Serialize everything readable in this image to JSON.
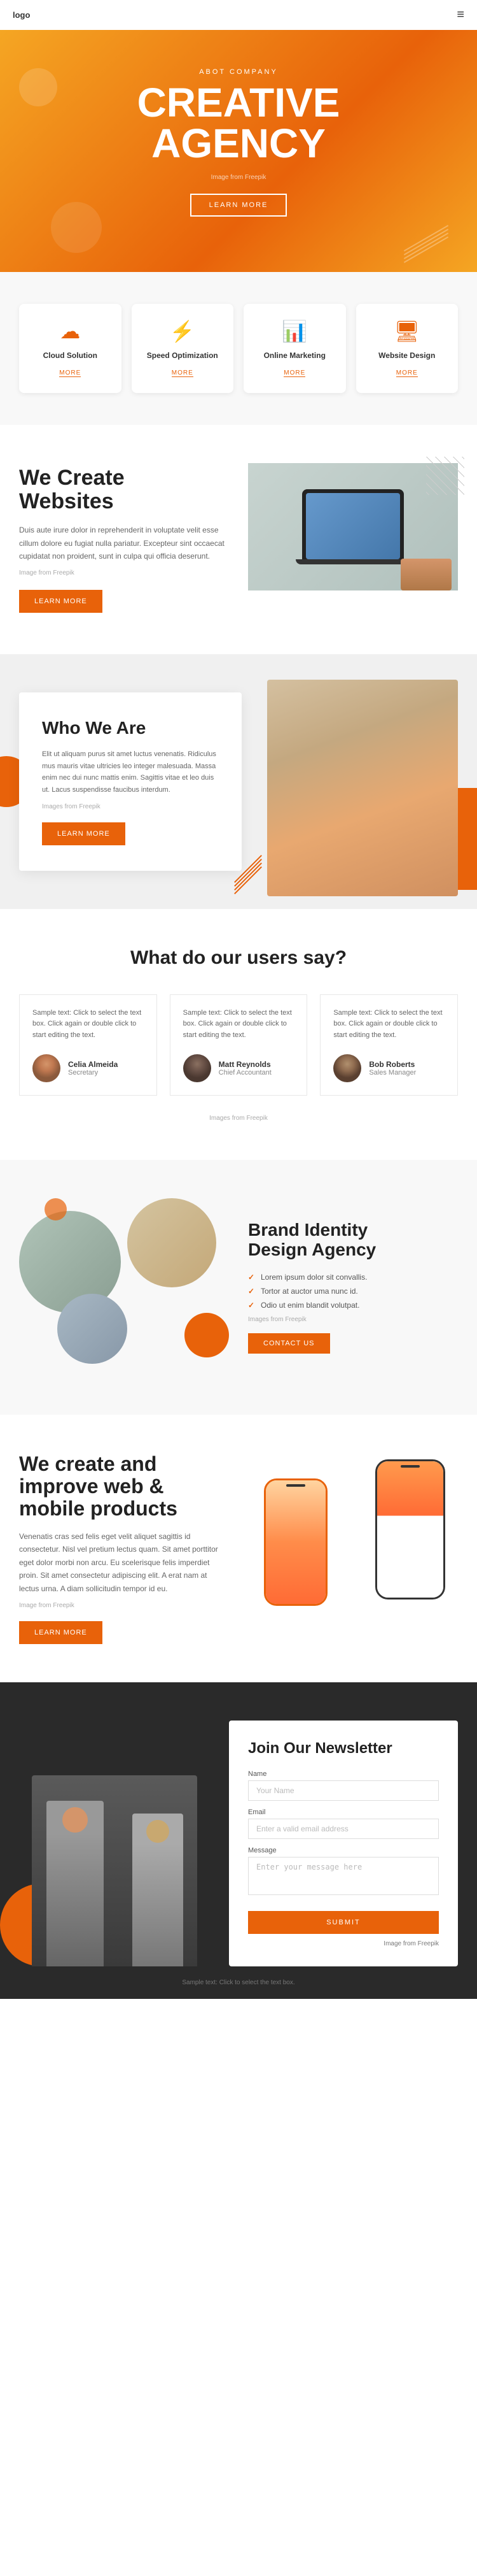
{
  "header": {
    "logo": "logo",
    "hamburger_icon": "≡"
  },
  "hero": {
    "subtitle": "ABOT COMPANY",
    "title_line1": "CREATIVE",
    "title_line2": "AGENCY",
    "img_credit": "Image from Freepik",
    "cta_label": "LEARN MORE"
  },
  "services": {
    "cards": [
      {
        "icon": "☁",
        "title": "Cloud Solution",
        "more": "MORE"
      },
      {
        "icon": "⚡",
        "title": "Speed Optimization",
        "more": "MORE"
      },
      {
        "icon": "📊",
        "title": "Online Marketing",
        "more": "MORE"
      },
      {
        "icon": "🖥",
        "title": "Website Design",
        "more": "MORE"
      }
    ]
  },
  "we_create": {
    "title_line1": "We Create",
    "title_line2": "Websites",
    "body": "Duis aute irure dolor in reprehenderit in voluptate velit esse cillum dolore eu fugiat nulla pariatur. Excepteur sint occaecat cupidatat non proident, sunt in culpa qui officia deserunt.",
    "img_credit": "Image from Freepik",
    "cta_label": "LEARN MORE"
  },
  "who_we_are": {
    "title": "Who We Are",
    "body": "Elit ut aliquam purus sit amet luctus venenatis. Ridiculus mus mauris vitae ultricies leo integer malesuada. Massa enim nec dui nunc mattis enim. Sagittis vitae et leo duis ut. Lacus suspendisse faucibus interdum.",
    "img_credit": "Images from Freepik",
    "cta_label": "LEARN MORE"
  },
  "testimonials": {
    "title": "What do our users say?",
    "cards": [
      {
        "text": "Sample text: Click to select the text box. Click again or double click to start editing the text.",
        "name": "Celia Almeida",
        "role": "Secretary"
      },
      {
        "text": "Sample text: Click to select the text box. Click again or double click to start editing the text.",
        "name": "Matt Reynolds",
        "role": "Chief Accountant"
      },
      {
        "text": "Sample text: Click to select the text box. Click again or double click to start editing the text.",
        "name": "Bob Roberts",
        "role": "Sales Manager"
      }
    ],
    "img_credit": "Images from Freepik"
  },
  "brand_identity": {
    "title_line1": "Brand Identity",
    "title_line2": "Design Agency",
    "checklist": [
      "Lorem ipsum dolor sit convallis.",
      "Tortor at auctor uma nunc id.",
      "Odio ut enim blandit volutpat."
    ],
    "img_credit": "Images from Freepik",
    "cta_label": "CONTACT US"
  },
  "mobile_products": {
    "title_line1": "We create and",
    "title_line2": "improve web &",
    "title_line3": "mobile products",
    "body": "Venenatis cras sed felis eget velit aliquet sagittis id consectetur. Nisl vel pretium lectus quam. Sit amet porttitor eget dolor morbi non arcu. Eu scelerisque felis imperdiet proin. Sit amet consectetur adipiscing elit. A erat nam at lectus urna. A diam sollicitudin tempor id eu.",
    "img_credit": "Image from Freepik",
    "cta_label": "LEARN MORE"
  },
  "newsletter": {
    "title": "Join Our Newsletter",
    "fields": [
      {
        "label": "Name",
        "placeholder": "Your Name"
      },
      {
        "label": "Email",
        "placeholder": "Enter a valid email address"
      },
      {
        "label": "Message",
        "placeholder": "Enter your message here"
      }
    ],
    "submit_label": "SUBMIT",
    "img_credit": "Image from Freepik"
  },
  "footer": {
    "note": "Sample text: Click to select the text box."
  }
}
